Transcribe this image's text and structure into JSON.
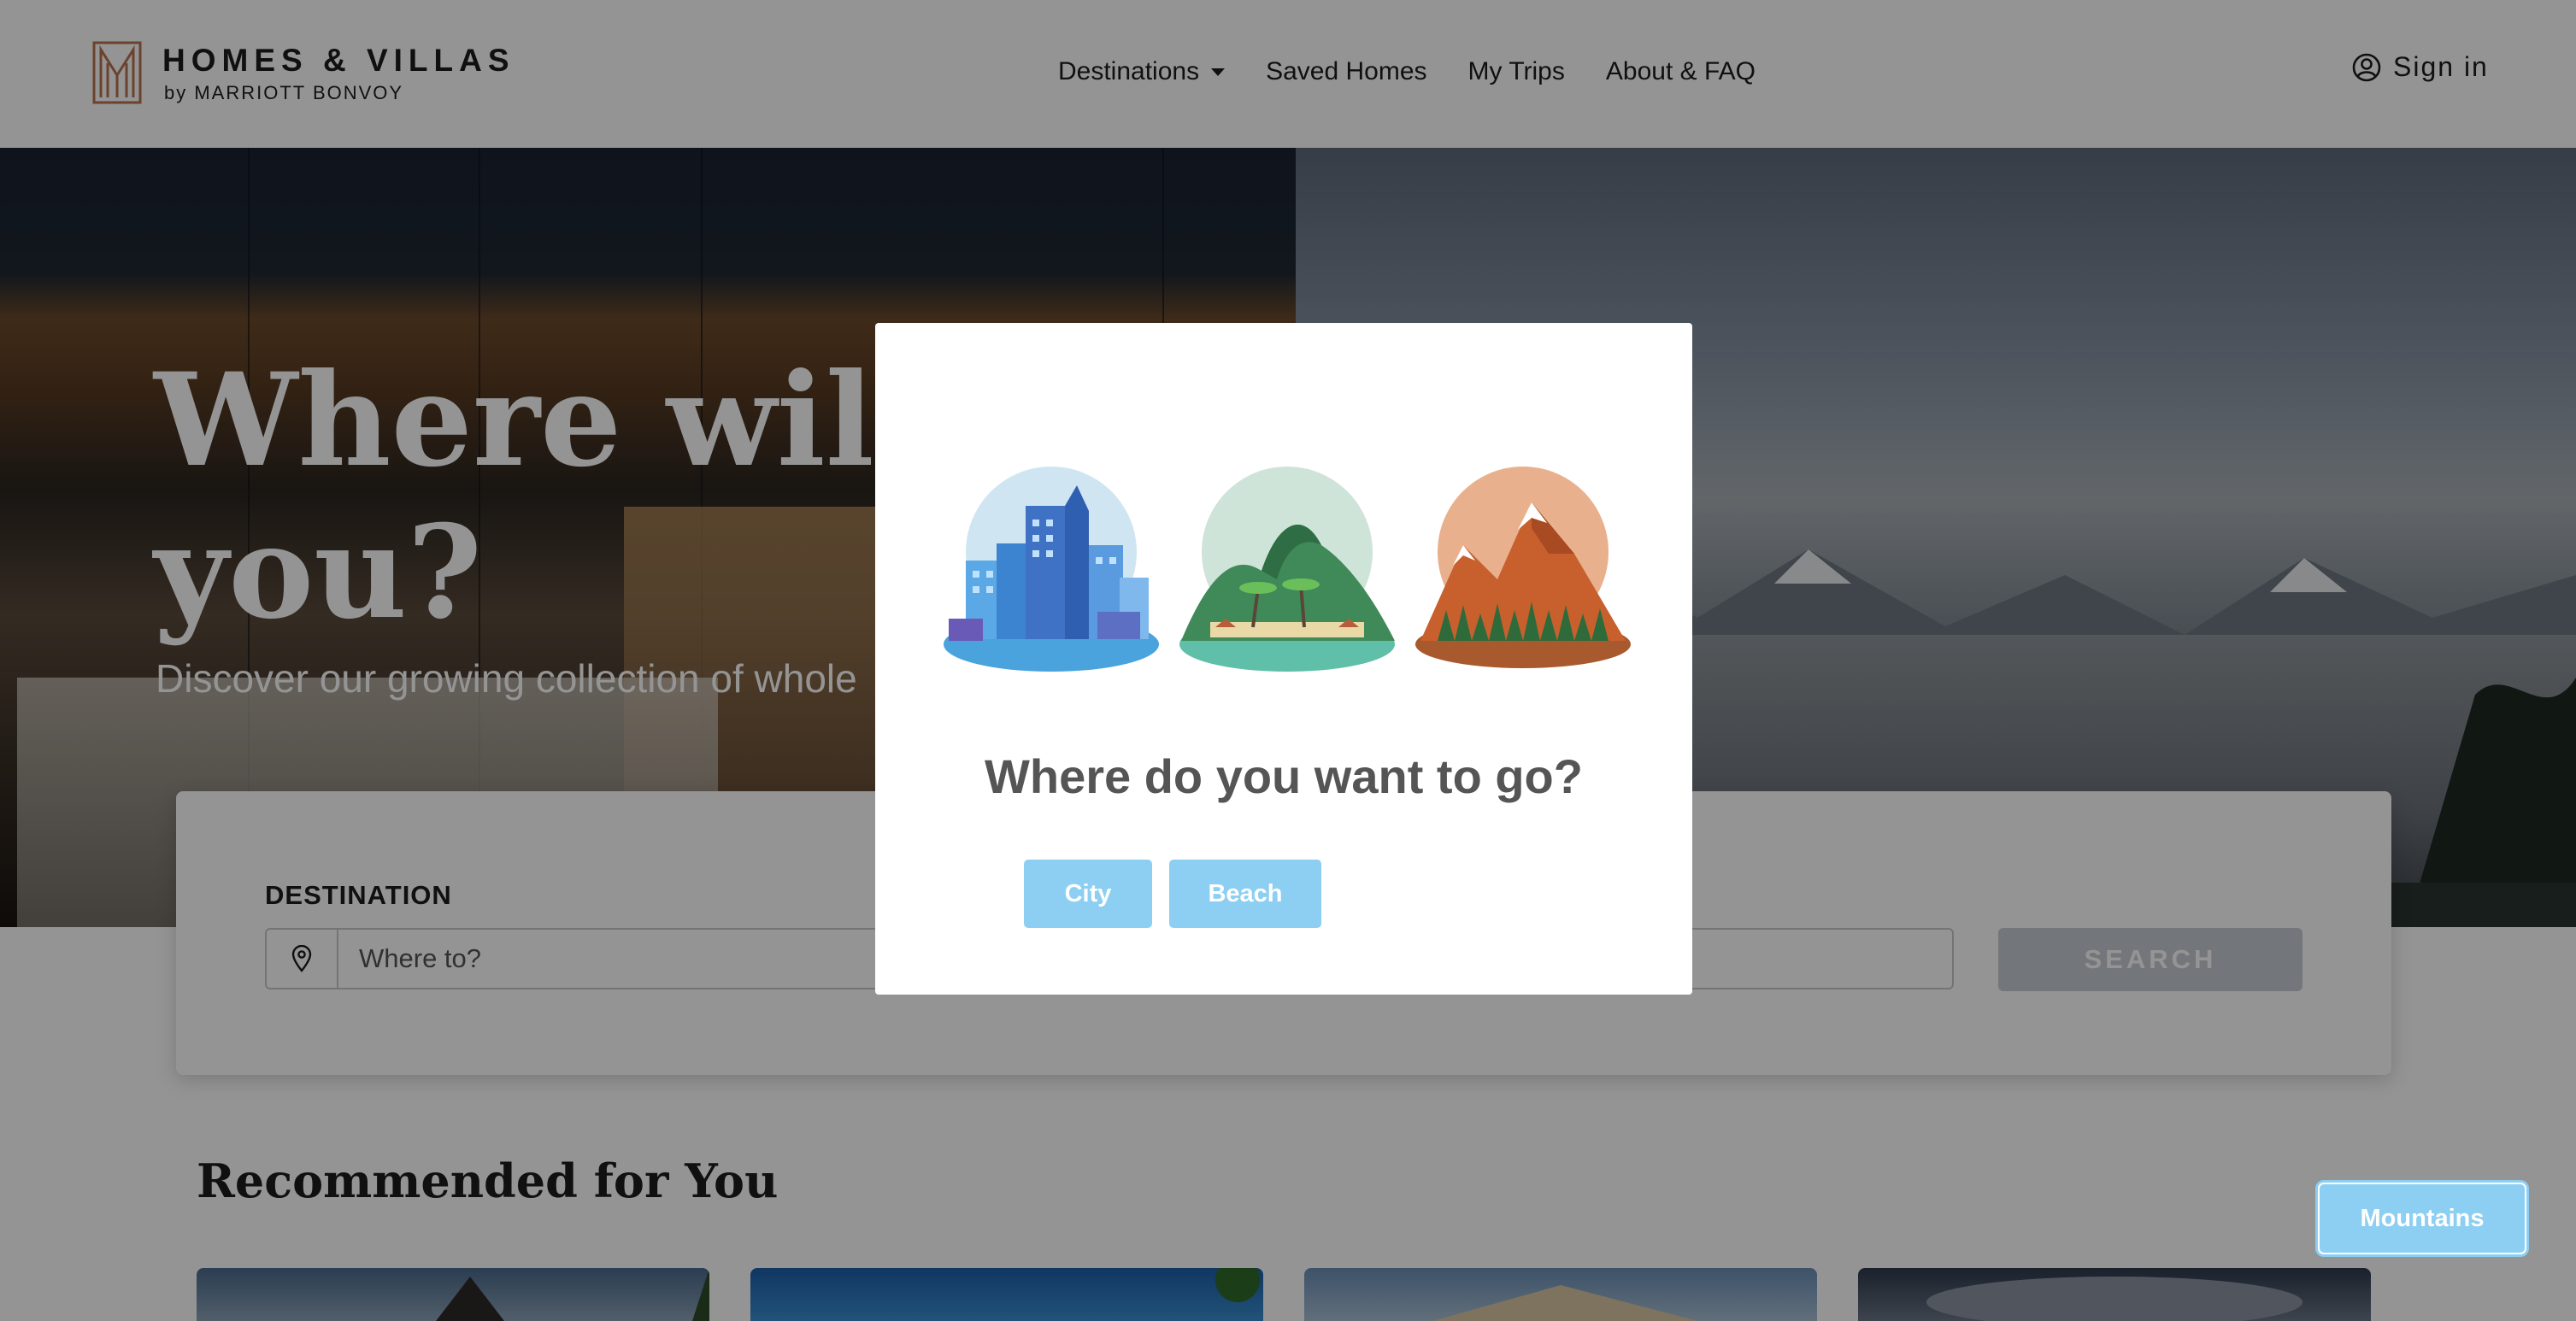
{
  "header": {
    "brand_name": "HOMES & VILLAS",
    "brand_sub": "by MARRIOTT BONVOY",
    "nav": [
      {
        "label": "Destinations",
        "has_dropdown": true
      },
      {
        "label": "Saved Homes"
      },
      {
        "label": "My Trips"
      },
      {
        "label": "About & FAQ"
      }
    ],
    "sign_in": "Sign in"
  },
  "hero": {
    "title_line1": "Where will yo",
    "title_line2": "you?",
    "subtitle": "Discover our growing collection of whole"
  },
  "search": {
    "destination_label": "DESTINATION",
    "destination_placeholder": "Where to?",
    "search_button": "SEARCH"
  },
  "recommendations": {
    "title": "Recommended for You"
  },
  "modal": {
    "title": "Where do you want to go?",
    "choices": [
      "City",
      "Beach",
      "Mountains"
    ],
    "selected": "Mountains",
    "illustrations": [
      "city-illustration",
      "beach-illustration",
      "mountains-illustration"
    ]
  },
  "colors": {
    "brand_copper": "#b8734f",
    "choice_button": "#8dcff2",
    "search_button": "#c7ced4",
    "modal_title": "#555555"
  }
}
